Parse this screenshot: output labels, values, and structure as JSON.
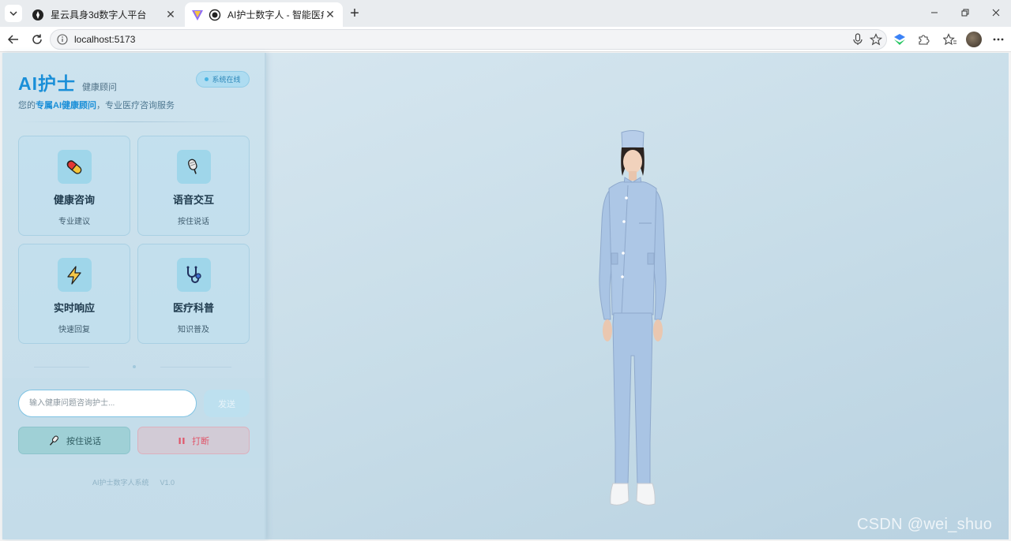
{
  "browser": {
    "tabs": [
      {
        "title": "星云具身3d数字人平台",
        "active": false
      },
      {
        "title": "AI护士数字人 - 智能医疗助手",
        "active": true
      }
    ],
    "url": "localhost:5173"
  },
  "sidebar": {
    "brand_title": "AI护士",
    "brand_subtitle": "健康顾问",
    "status": "系统在线",
    "tagline_prefix": "您的",
    "tagline_highlight": "专属AI健康顾问",
    "tagline_suffix": "，专业医疗咨询服务",
    "features": [
      {
        "title": "健康咨询",
        "desc": "专业建议",
        "icon": "pill-icon"
      },
      {
        "title": "语音交互",
        "desc": "按住说话",
        "icon": "microphone-icon"
      },
      {
        "title": "实时响应",
        "desc": "快速回复",
        "icon": "lightning-icon"
      },
      {
        "title": "医疗科普",
        "desc": "知识普及",
        "icon": "stethoscope-icon"
      }
    ],
    "input_placeholder": "输入健康问题咨询护士...",
    "send_label": "发送",
    "voice_label": "按住说话",
    "stop_label": "打断",
    "footer_name": "AI护士数字人系统",
    "footer_version": "V1.0"
  },
  "watermark": "CSDN @wei_shuo",
  "colors": {
    "accent": "#1a8fd8",
    "stop": "#e0566a",
    "uniform": "#a9c4e4"
  }
}
